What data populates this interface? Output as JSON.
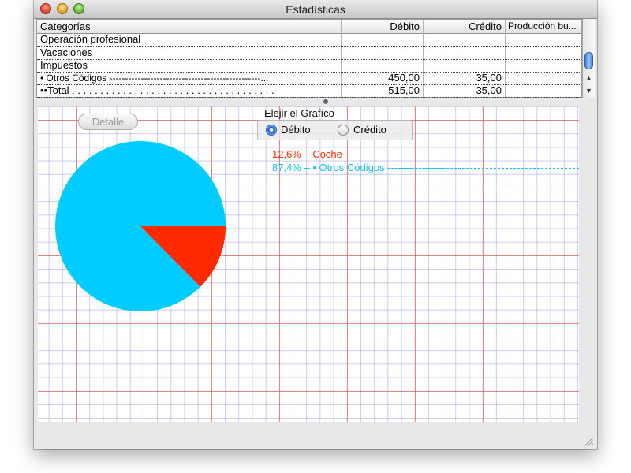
{
  "window": {
    "title": "Estadísticas"
  },
  "table": {
    "headers": [
      "Categorías",
      "Débito",
      "Crédito",
      "Producción bu..."
    ],
    "rows": [
      {
        "category": "Operación profesional",
        "debit": "",
        "credit": ""
      },
      {
        "category": "Vacaciones",
        "debit": "",
        "credit": ""
      },
      {
        "category": "Impuestos",
        "debit": "",
        "credit": ""
      },
      {
        "category": "• Otros Códigos ------------------------------------------------...",
        "debit": "450,00",
        "credit": "35,00"
      },
      {
        "category": "••Total . . . . . . . . . . . . . . . . . . . . . . . . . . . . . . . . . . . .",
        "debit": "515,00",
        "credit": "35,00"
      }
    ]
  },
  "graph": {
    "detail_button": "Detalle",
    "choose_label": "Elejir el Grafíco",
    "radio_debit": "Débito",
    "radio_credit": "Crédito",
    "selected": "debit",
    "legend": [
      {
        "text": "12,6% – Coche",
        "color": "#ff2a00"
      },
      {
        "text": "87,4% – • Otros Códigos -----------------",
        "color": "#12c2f0"
      }
    ]
  },
  "chart_data": {
    "type": "pie",
    "slices": [
      {
        "label": "Coche",
        "percent": 12.6,
        "color": "#ff2a00"
      },
      {
        "label": "• Otros Códigos",
        "percent": 87.4,
        "color": "#00ccff"
      }
    ]
  }
}
